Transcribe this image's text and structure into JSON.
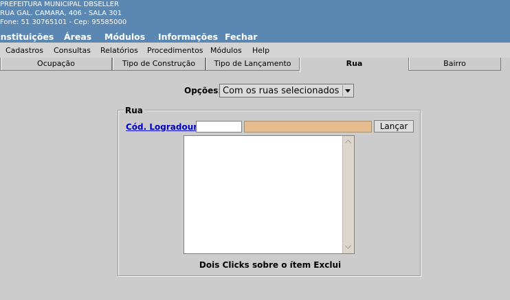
{
  "header": {
    "org_name": "PREFEITURA MUNICIPAL DBSELLER",
    "address": "RUA GAL. CAMARA, 406 - SALA 301",
    "contact": "Fone: 51 30765101  -  Cep: 95585000",
    "colors": {
      "header_bg": "#5b87b3",
      "page_bg": "#cccccc",
      "link": "#0000cc",
      "readonly_field": "#e6bd8e"
    }
  },
  "main_menu": [
    "Instituições",
    "Áreas",
    "Módulos",
    "Informações",
    "Fechar"
  ],
  "sub_menu": [
    "Cadastros",
    "Consultas",
    "Relatórios",
    "Procedimentos",
    "Módulos",
    "Help"
  ],
  "tabs": [
    {
      "label": "Ocupação",
      "active": false
    },
    {
      "label": "Tipo de Construção",
      "active": false
    },
    {
      "label": "Tipo de Lançamento",
      "active": false
    },
    {
      "label": "Rua",
      "active": true
    },
    {
      "label": "Bairro",
      "active": false
    }
  ],
  "options": {
    "label": "Opções:",
    "selected": "Com os ruas selecionados"
  },
  "group": {
    "legend": "Rua",
    "code_link": "Cód. Logradouro:",
    "code_value": "",
    "name_value": "",
    "button": "Lançar",
    "list_items": [],
    "help_text": "Dois Clicks sobre o ítem Exclui"
  }
}
